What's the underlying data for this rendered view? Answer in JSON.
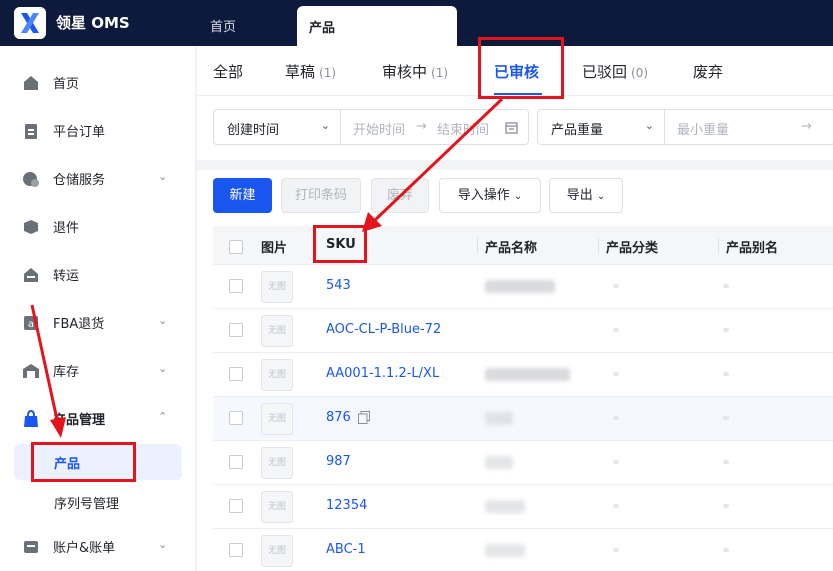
{
  "header": {
    "brand": "领星 OMS",
    "tabs": [
      {
        "label": "首页",
        "active": false
      },
      {
        "label": "产品",
        "active": true
      }
    ]
  },
  "sidebar": {
    "items": [
      {
        "label": "首页",
        "icon": "home-icon",
        "expandable": false
      },
      {
        "label": "平台订单",
        "icon": "clipboard-icon",
        "expandable": false
      },
      {
        "label": "仓储服务",
        "icon": "warehouse-service-icon",
        "expandable": true
      },
      {
        "label": "退件",
        "icon": "return-box-icon",
        "expandable": false
      },
      {
        "label": "转运",
        "icon": "transfer-icon",
        "expandable": false
      },
      {
        "label": "FBA退货",
        "icon": "fba-icon",
        "expandable": true
      },
      {
        "label": "库存",
        "icon": "inventory-icon",
        "expandable": true
      },
      {
        "label": "产品管理",
        "icon": "bag-icon",
        "expandable": true,
        "expanded": true
      },
      {
        "label": "账户&账单",
        "icon": "account-icon",
        "expandable": true
      }
    ],
    "sub_items": [
      {
        "label": "产品",
        "active": true
      },
      {
        "label": "序列号管理",
        "active": false
      }
    ]
  },
  "status_tabs": [
    {
      "label": "全部",
      "count": ""
    },
    {
      "label": "草稿",
      "count": "(1)"
    },
    {
      "label": "审核中",
      "count": "(1)"
    },
    {
      "label": "已审核",
      "count": "",
      "active": true
    },
    {
      "label": "已驳回",
      "count": "(0)"
    },
    {
      "label": "废弃",
      "count": ""
    }
  ],
  "filters": {
    "date_select": "创建时间",
    "start_placeholder": "开始时间",
    "arrow": "→",
    "end_placeholder": "结束时间",
    "weight_select": "产品重量",
    "min_weight_placeholder": "最小重量",
    "weight_arrow": "→"
  },
  "toolbar": {
    "new_label": "新建",
    "print_label": "打印条码",
    "discard_label": "废弃",
    "import_label": "导入操作",
    "export_label": "导出"
  },
  "table": {
    "headers": [
      "图片",
      "SKU",
      "产品名称",
      "产品分类",
      "产品别名"
    ],
    "no_image_text": "无图",
    "rows": [
      {
        "sku": "543",
        "copy_icon": false
      },
      {
        "sku": "AOC-CL-P-Blue-72",
        "copy_icon": false
      },
      {
        "sku": "AA001-1.1.2-L/XL",
        "copy_icon": false
      },
      {
        "sku": "876",
        "copy_icon": true
      },
      {
        "sku": "987",
        "copy_icon": false
      },
      {
        "sku": "12354",
        "copy_icon": false
      },
      {
        "sku": "ABC-1",
        "copy_icon": false
      }
    ]
  },
  "colors": {
    "accent": "#1a56f0",
    "topbar": "#0e1a3b",
    "annotation": "#e3141b"
  }
}
